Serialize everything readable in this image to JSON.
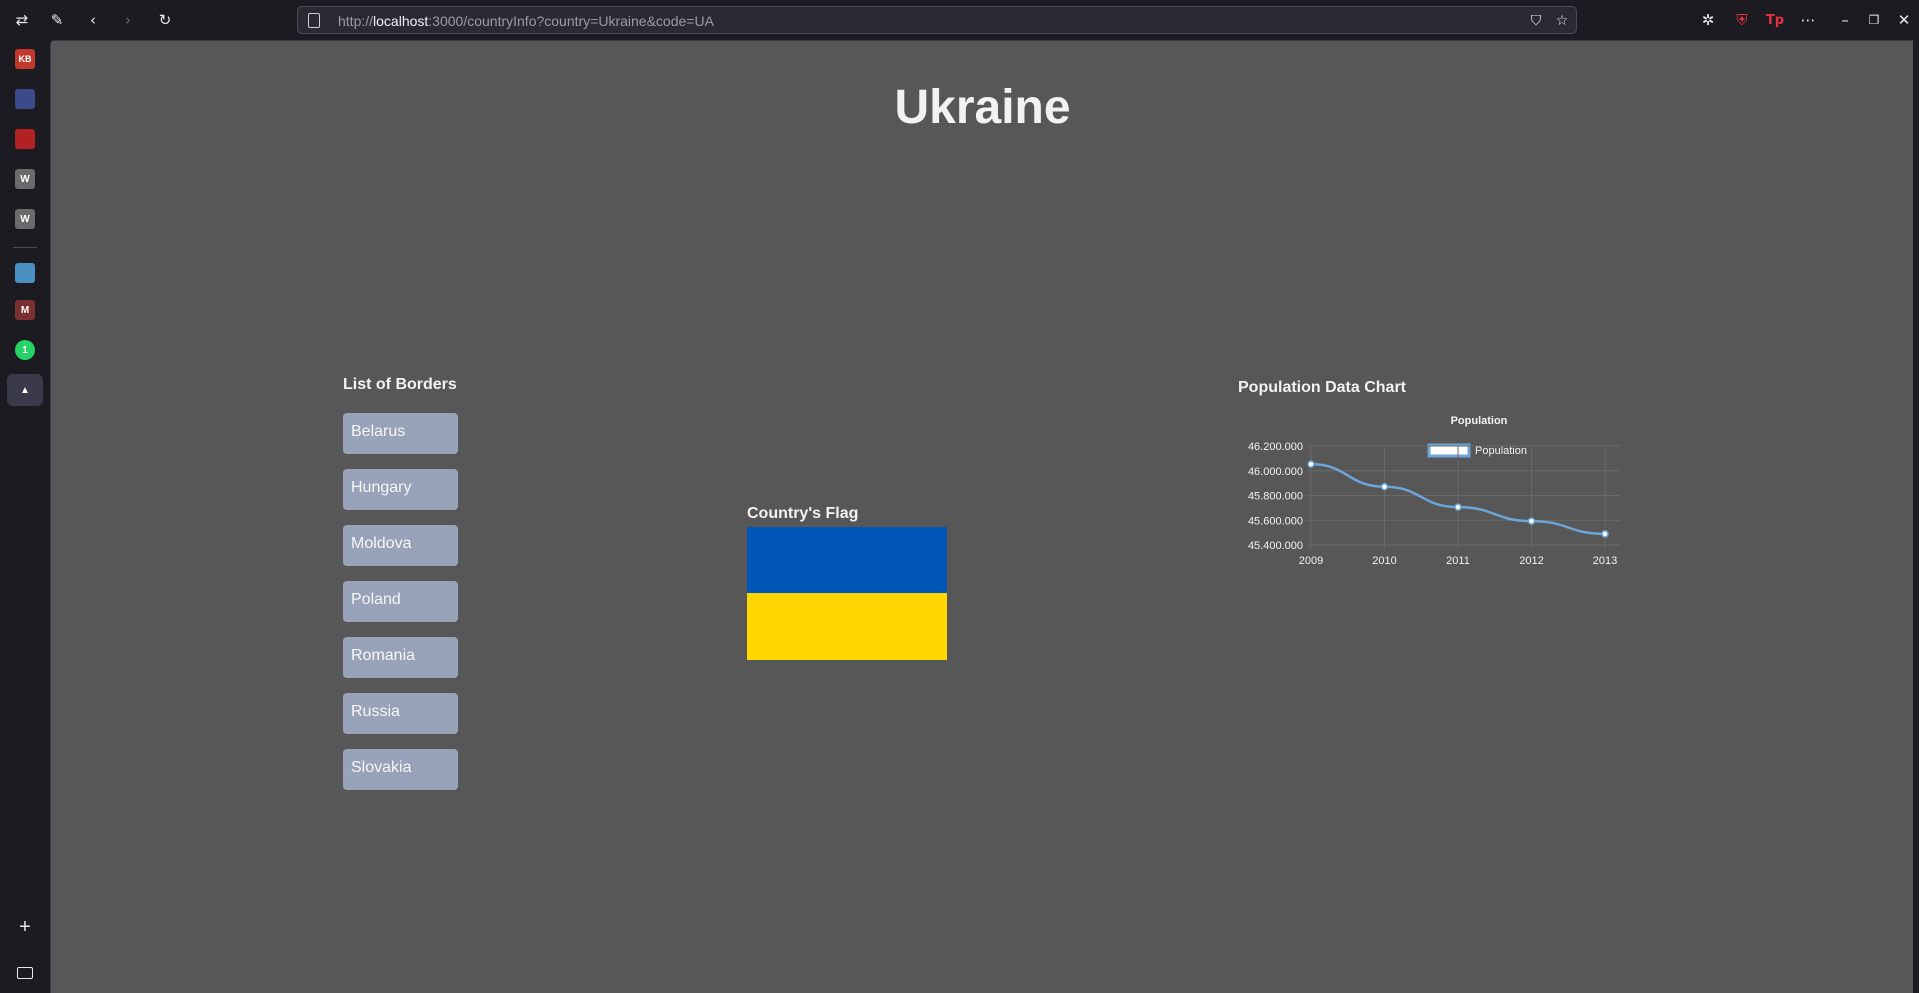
{
  "browser": {
    "url_scheme": "http://",
    "url_host": "localhost",
    "url_rest": ":3000/countryInfo?country=Ukraine&code=UA",
    "icons": [
      "sidebar-toggle-icon",
      "extension-icon",
      "back-icon",
      "forward-icon",
      "reload-icon",
      "page-icon",
      "shield-icon",
      "star-icon",
      "puzzle-icon",
      "ublock-icon",
      "translate-icon",
      "more-icon",
      "minimize-icon",
      "restore-icon",
      "close-icon"
    ]
  },
  "sidebar": {
    "items": [
      {
        "name": "kb-icon",
        "label": "KB",
        "color": "#c0392b"
      },
      {
        "name": "board-icon",
        "label": "",
        "color": "#3b4a8a"
      },
      {
        "name": "red-app-icon",
        "label": "",
        "color": "#b22222"
      },
      {
        "name": "wikipedia-icon",
        "label": "W",
        "color": "#6b6b6b"
      },
      {
        "name": "wikipedia-icon-2",
        "label": "W",
        "color": "#6b6b6b"
      },
      {
        "name": "ship-icon",
        "label": "",
        "color": "#4a90c2"
      },
      {
        "name": "gmail-icon",
        "label": "M",
        "color": "#7a3030"
      },
      {
        "name": "whatsapp-icon",
        "label": "1",
        "color": "#25d366"
      },
      {
        "name": "arch-icon",
        "label": "▲",
        "color": "#3a3a4a"
      }
    ],
    "add_label": "+"
  },
  "page": {
    "title": "Ukraine",
    "borders_heading": "List of Borders",
    "borders": [
      "Belarus",
      "Hungary",
      "Moldova",
      "Poland",
      "Romania",
      "Russia",
      "Slovakia"
    ],
    "flag_heading": "Country's Flag",
    "flag_colors": {
      "top": "#0057b8",
      "bottom": "#ffd700"
    },
    "chart_heading": "Population Data Chart"
  },
  "chart_data": {
    "type": "line",
    "title": "Population",
    "x": [
      "2009",
      "2010",
      "2011",
      "2012",
      "2013"
    ],
    "series": [
      {
        "name": "Population",
        "values": [
          46053300,
          45870700,
          45706100,
          45593300,
          45489600
        ],
        "color": "#6ca6d9"
      }
    ],
    "ylim": [
      45400000,
      46200000
    ],
    "yticks": [
      "46.200.000",
      "46.000.000",
      "45.800.000",
      "45.600.000",
      "45.400.000"
    ],
    "grid": true,
    "legend": "top"
  }
}
